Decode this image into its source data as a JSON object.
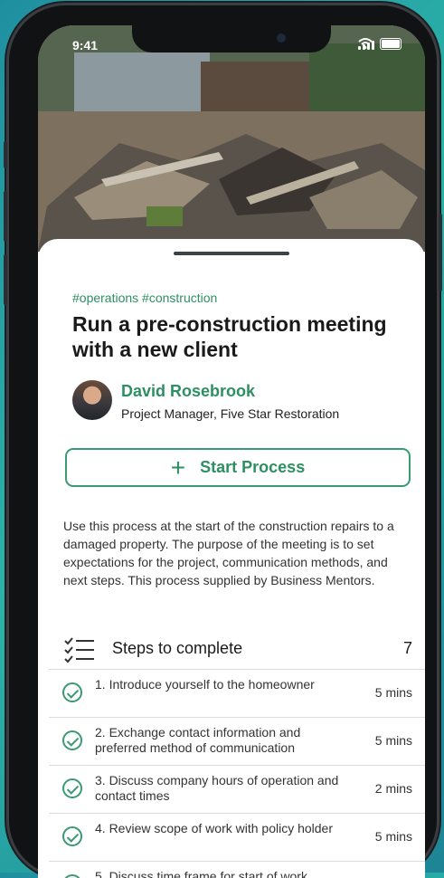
{
  "status_bar": {
    "time": "9:41"
  },
  "post": {
    "tags": "#operations #construction",
    "title": "Run a pre-construction meeting with a new client",
    "author": {
      "name": "David Rosebrook",
      "role": "Project Manager, Five Star Restoration"
    },
    "start_button": {
      "icon": "plus-icon",
      "label": "Start Process"
    },
    "description": "Use this process at the start of the construction repairs to a damaged property.  The purpose of the meeting is to set expectations for the project, communication methods, and next steps. This process supplied by Business Mentors."
  },
  "steps_section": {
    "label": "Steps to complete",
    "count": "7"
  },
  "steps": [
    {
      "label": "1. Introduce yourself to the homeowner",
      "duration": "5 mins"
    },
    {
      "label": "2. Exchange contact information and preferred method of communication",
      "duration": "5 mins"
    },
    {
      "label": "3. Discuss company hours of operation and contact times",
      "duration": "2 mins"
    },
    {
      "label": "4. Review scope of work with policy holder",
      "duration": "5 mins"
    },
    {
      "label": "5. Discuss time frame for start of work",
      "duration": ""
    }
  ],
  "colors": {
    "accent": "#2e8f63",
    "background": "#1f8fa0"
  }
}
